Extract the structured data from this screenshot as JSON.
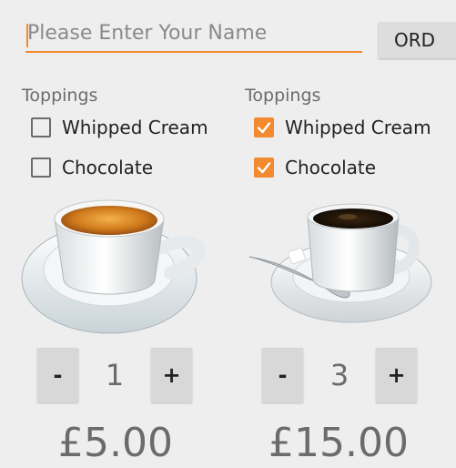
{
  "name_field": {
    "placeholder": "Please Enter Your Name",
    "value": ""
  },
  "order_button": {
    "label": "ORD"
  },
  "colors": {
    "accent": "#f28a30",
    "background": "#eeeeee",
    "button": "#dddddd"
  },
  "orders": [
    {
      "toppings_label": "Toppings",
      "toppings": [
        {
          "label": "Whipped Cream",
          "checked": false
        },
        {
          "label": "Chocolate",
          "checked": false
        }
      ],
      "image": "espresso-cup-icon",
      "quantity": "1",
      "minus_label": "-",
      "plus_label": "+",
      "price": "£5.00"
    },
    {
      "toppings_label": "Toppings",
      "toppings": [
        {
          "label": "Whipped Cream",
          "checked": true
        },
        {
          "label": "Chocolate",
          "checked": true
        }
      ],
      "image": "black-coffee-cup-icon",
      "quantity": "3",
      "minus_label": "-",
      "plus_label": "+",
      "price": "£15.00"
    }
  ]
}
